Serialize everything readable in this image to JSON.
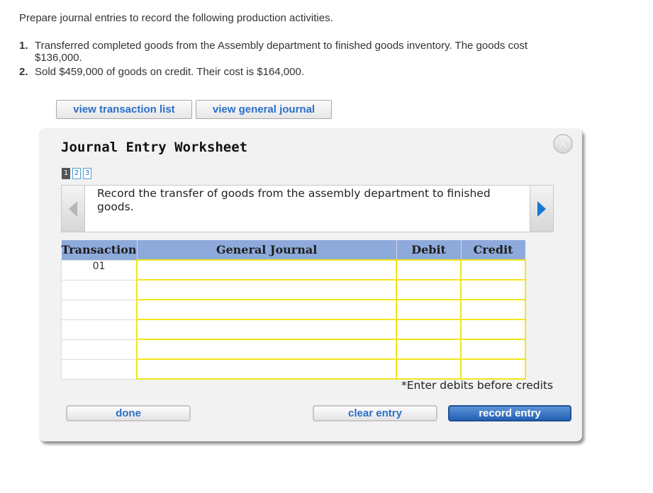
{
  "question": {
    "intro": "Prepare journal entries to record the following production activities.",
    "requirements": [
      {
        "num": "1.",
        "text": "Transferred completed goods from the Assembly department to finished goods inventory. The goods cost $136,000."
      },
      {
        "num": "2.",
        "text": "Sold $459,000 of goods on credit. Their cost is $164,000."
      }
    ]
  },
  "top_buttons": {
    "transaction_list": "view transaction list",
    "general_journal": "view general journal"
  },
  "worksheet": {
    "title": "Journal Entry Worksheet",
    "close_label": "X",
    "pages": [
      "1",
      "2",
      "3"
    ],
    "active_page": "1",
    "instruction": "Record the transfer of goods from the assembly department to finished goods.",
    "columns": [
      "Transaction",
      "General Journal",
      "Debit",
      "Credit"
    ],
    "rows": [
      {
        "transaction": "01",
        "account": "",
        "debit": "",
        "credit": ""
      },
      {
        "transaction": "",
        "account": "",
        "debit": "",
        "credit": ""
      },
      {
        "transaction": "",
        "account": "",
        "debit": "",
        "credit": ""
      },
      {
        "transaction": "",
        "account": "",
        "debit": "",
        "credit": ""
      },
      {
        "transaction": "",
        "account": "",
        "debit": "",
        "credit": ""
      },
      {
        "transaction": "",
        "account": "",
        "debit": "",
        "credit": ""
      }
    ],
    "hint": "*Enter debits before credits",
    "buttons": {
      "done": "done",
      "clear": "clear entry",
      "record": "record entry"
    }
  },
  "icons": {
    "prev": "chevron-left-icon",
    "next": "chevron-right-icon",
    "close": "close-icon"
  },
  "colors": {
    "header_bg": "#8eaadb",
    "input_border": "#f2e61a",
    "link_blue": "#2a6fc9",
    "primary_button": "#2361b4"
  }
}
